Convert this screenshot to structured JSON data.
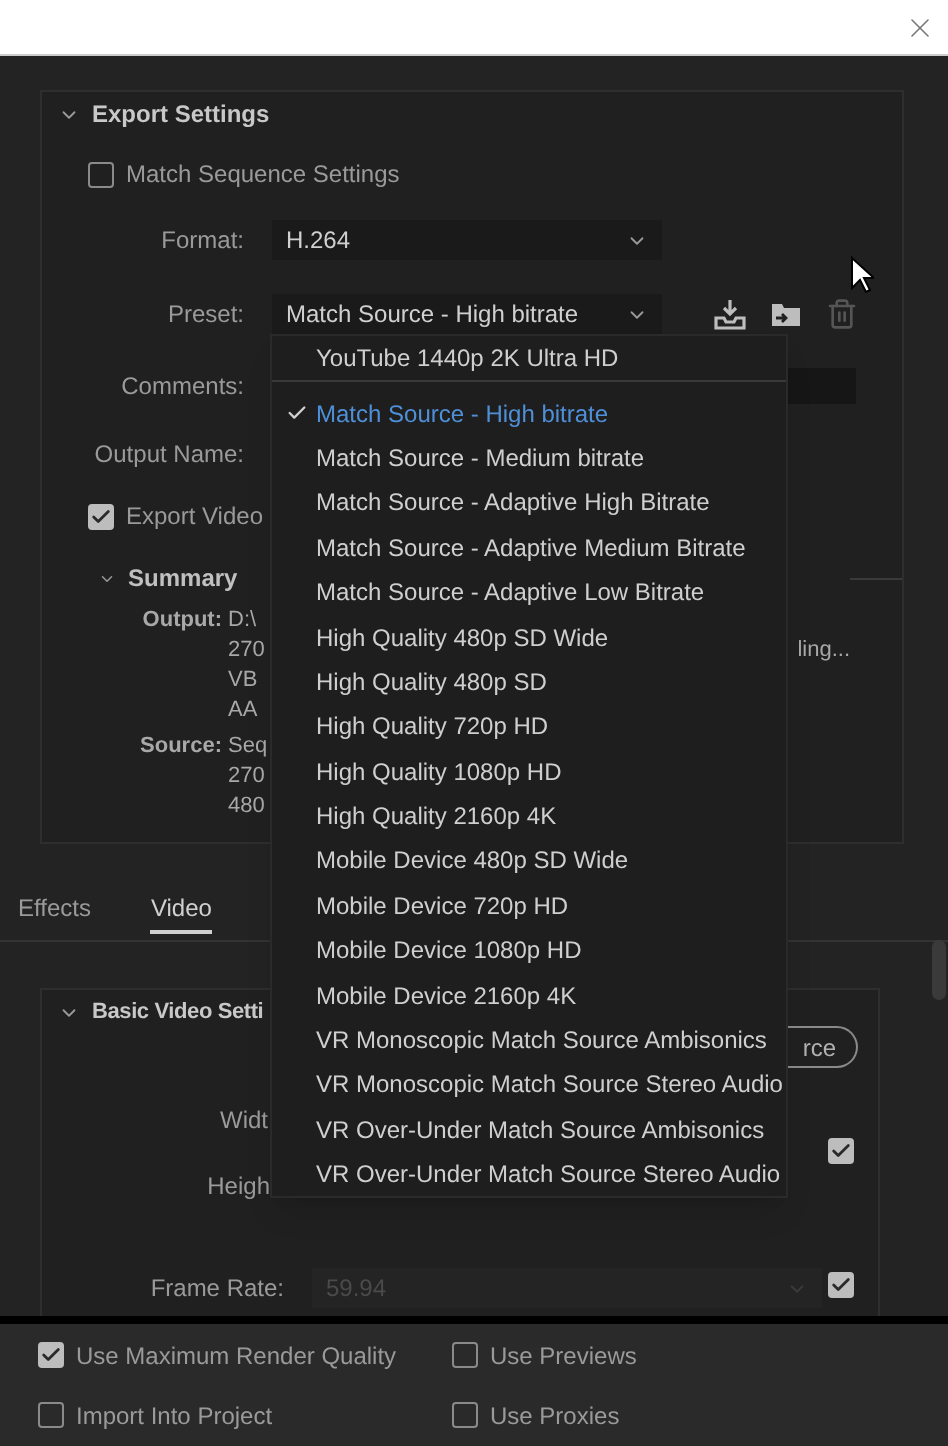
{
  "export_settings": {
    "title": "Export Settings",
    "expanded": true,
    "match_sequence_settings": {
      "label": "Match Sequence Settings",
      "checked": false
    },
    "format": {
      "label": "Format:",
      "value": "H.264"
    },
    "preset": {
      "label": "Preset:",
      "value": "Match Source - High bitrate",
      "menu": [
        {
          "label": "YouTube 1440p 2K Ultra HD",
          "selected": false,
          "separator_below": true
        },
        {
          "label": "Match Source - High bitrate",
          "selected": true
        },
        {
          "label": "Match Source - Medium bitrate",
          "selected": false
        },
        {
          "label": "Match Source - Adaptive High Bitrate",
          "selected": false
        },
        {
          "label": "Match Source - Adaptive Medium Bitrate",
          "selected": false
        },
        {
          "label": "Match Source - Adaptive Low Bitrate",
          "selected": false
        },
        {
          "label": "High Quality 480p SD Wide",
          "selected": false
        },
        {
          "label": "High Quality 480p SD",
          "selected": false
        },
        {
          "label": "High Quality 720p HD",
          "selected": false
        },
        {
          "label": "High Quality 1080p HD",
          "selected": false
        },
        {
          "label": "High Quality 2160p 4K",
          "selected": false
        },
        {
          "label": "Mobile Device 480p SD Wide",
          "selected": false
        },
        {
          "label": "Mobile Device 720p HD",
          "selected": false
        },
        {
          "label": "Mobile Device 1080p HD",
          "selected": false
        },
        {
          "label": "Mobile Device 2160p 4K",
          "selected": false
        },
        {
          "label": "VR Monoscopic Match Source Ambisonics",
          "selected": false
        },
        {
          "label": "VR Monoscopic Match Source Stereo Audio",
          "selected": false
        },
        {
          "label": "VR Over-Under Match Source Ambisonics",
          "selected": false
        },
        {
          "label": "VR Over-Under Match Source Stereo Audio",
          "selected": false
        }
      ]
    },
    "comments": {
      "label": "Comments:"
    },
    "output_name": {
      "label": "Output Name:"
    },
    "export_video": {
      "label": "Export Video",
      "checked": true
    },
    "summary": {
      "title": "Summary",
      "expanded": true,
      "output": {
        "label": "Output:",
        "lines": [
          "D:\\",
          "270",
          "VB",
          "AA"
        ],
        "line_2_tail": "ling..."
      },
      "source": {
        "label": "Source:",
        "lines": [
          "Seq",
          "270",
          "480"
        ]
      }
    }
  },
  "tabs": [
    {
      "label": "Effects",
      "selected": false
    },
    {
      "label": "Video",
      "selected": true
    }
  ],
  "basic_video_settings": {
    "title": "Basic Video Setti",
    "expanded": true,
    "button": "rce",
    "width": {
      "label": "Widt"
    },
    "height": {
      "label": "Heigh"
    },
    "link_checked": true,
    "frame_rate": {
      "label": "Frame Rate:",
      "value": "59.94",
      "disabled": true,
      "checked": true
    }
  },
  "bottom_options": [
    {
      "label": "Use Maximum Render Quality",
      "checked": true
    },
    {
      "label": "Use Previews",
      "checked": false
    },
    {
      "label": "Import Into Project",
      "checked": false
    },
    {
      "label": "Use Proxies",
      "checked": false
    }
  ]
}
